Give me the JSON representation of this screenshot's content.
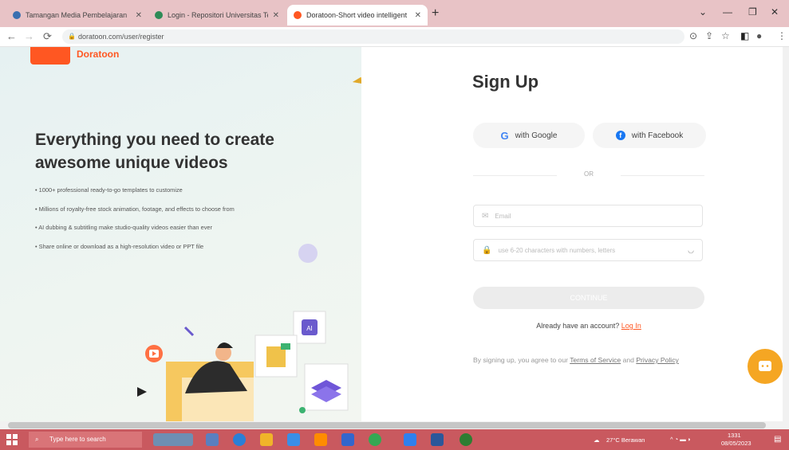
{
  "browser": {
    "tabs": [
      {
        "title": "Tamangan Media Pembelajaran",
        "active": false
      },
      {
        "title": "Login - Repositori Universitas Terbuka",
        "active": false
      },
      {
        "title": "Doratoon-Short video intelligent",
        "active": true
      }
    ],
    "url": "doratoon.com/user/register"
  },
  "brand": {
    "name": "Doratoon",
    "accent": "#ff5722"
  },
  "left_panel": {
    "headline": "Everything you need to create awesome unique videos",
    "bullets": [
      "• 1000+ professional ready-to-go templates to customize",
      "• Millions of royalty-free stock animation, footage, and effects to choose from",
      "• AI dubbing & subtitling make studio-quality videos easier than ever",
      "• Share online or download as a high-resolution video or PPT file"
    ],
    "ai_badge": "AI"
  },
  "signup": {
    "title": "Sign Up",
    "google_label": "with Google",
    "facebook_label": "with Facebook",
    "or_label": "OR",
    "email_placeholder": "Email",
    "password_placeholder": "use 6-20 characters with numbers, letters",
    "continue_label": "CONTINUE",
    "have_account": "Already have an account?",
    "login_link": "Log In",
    "terms_prefix": "By signing up, you agree to our",
    "terms_link": "Terms of Service",
    "terms_and": "and",
    "privacy_link": "Privacy Policy"
  },
  "taskbar": {
    "search_placeholder": "Type here to search",
    "weather": "27°C Berawan",
    "time": "1331",
    "date": "08/05/2023"
  },
  "colors": {
    "tabbar": "#e8c3c6",
    "taskbar": "#c9595f",
    "chat_fab": "#f5a623",
    "facebook": "#1877f2"
  }
}
